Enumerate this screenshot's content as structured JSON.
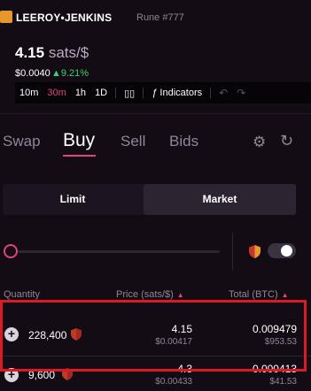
{
  "header": {
    "token_name": "LEEROY•JENKINS",
    "rune_label": "Rune #777",
    "price_value": "4.15",
    "price_unit": "sats/$",
    "price_usd": "$0.0040",
    "price_change": "▲9.21%"
  },
  "toolbar": {
    "timeframes": [
      "10m",
      "30m",
      "1h",
      "1D"
    ],
    "active_timeframe": "30m",
    "indicators_label": "Indicators"
  },
  "tabs": {
    "swap": "Swap",
    "buy": "Buy",
    "sell": "Sell",
    "bids": "Bids",
    "active": "Buy"
  },
  "order_type": {
    "limit": "Limit",
    "market": "Market",
    "selected": "Market"
  },
  "slider": {
    "value": 0
  },
  "toggle": {
    "on": true
  },
  "table": {
    "headers": {
      "quantity": "Quantity",
      "price": "Price (sats/$)",
      "total": "Total (BTC)"
    },
    "rows": [
      {
        "quantity": "228,400",
        "price": "4.15",
        "price_usd": "$0.00417",
        "total": "0.009479",
        "total_usd": "$953.53"
      },
      {
        "quantity": "9,600",
        "price": "4.3",
        "price_usd": "$0.00433",
        "total": "0.000413",
        "total_usd": "$41.53"
      }
    ]
  },
  "colors": {
    "background": "#130c14",
    "accent": "#e0447a",
    "positive": "#3ecf6e",
    "highlight_border": "#dc1a24"
  }
}
